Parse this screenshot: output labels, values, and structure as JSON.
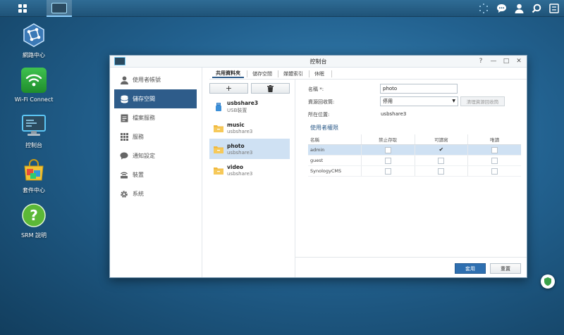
{
  "taskbar": {
    "main_menu_icon": "grid-icon",
    "open_app_icon": "control-panel-icon",
    "right_icons": [
      "network-dots-icon",
      "chat-icon",
      "user-icon",
      "search-icon",
      "options-icon"
    ]
  },
  "desktop": {
    "icons": [
      {
        "label": "網路中心",
        "icon": "network-center-icon"
      },
      {
        "label": "Wi-Fi Connect",
        "icon": "wifi-icon"
      },
      {
        "label": "控制台",
        "icon": "control-panel-icon"
      },
      {
        "label": "套件中心",
        "icon": "package-center-icon"
      },
      {
        "label": "SRM 說明",
        "icon": "help-icon"
      }
    ]
  },
  "window": {
    "title": "控制台",
    "controls": [
      "?",
      "—",
      "□",
      "✕"
    ],
    "sidebar": [
      {
        "label": "使用者帳號",
        "icon": "user-icon",
        "active": false
      },
      {
        "label": "儲存空間",
        "icon": "storage-icon",
        "active": true
      },
      {
        "label": "檔案服務",
        "icon": "file-services-icon",
        "active": false
      },
      {
        "label": "服務",
        "icon": "services-icon",
        "active": false
      },
      {
        "label": "通知設定",
        "icon": "notification-icon",
        "active": false
      },
      {
        "label": "裝置",
        "icon": "device-icon",
        "active": false
      },
      {
        "label": "系統",
        "icon": "system-icon",
        "active": false
      }
    ],
    "tabs": [
      {
        "label": "共用資料夾",
        "active": true
      },
      {
        "label": "儲存空間",
        "active": false
      },
      {
        "label": "媒體索引",
        "active": false
      },
      {
        "label": "休眠",
        "active": false
      }
    ],
    "list_toolbar": {
      "add": "+",
      "delete_icon": "trash-icon"
    },
    "shares": [
      {
        "name": "usbshare3",
        "sub": "USB裝置",
        "icon": "usb-icon",
        "selected": false
      },
      {
        "name": "music",
        "sub": "usbshare3",
        "icon": "folder-icon",
        "selected": false
      },
      {
        "name": "photo",
        "sub": "usbshare3",
        "icon": "folder-icon",
        "selected": true
      },
      {
        "name": "video",
        "sub": "usbshare3",
        "icon": "folder-icon",
        "selected": false
      }
    ],
    "form": {
      "name_label": "名稱 *:",
      "name_value": "photo",
      "recycle_label": "資源回收筒:",
      "recycle_value": "停用",
      "clear_recycle_btn": "清理資源回收筒",
      "location_label": "所在位置:",
      "location_value": "usbshare3",
      "perm_title": "使用者權限",
      "perm_headers": [
        "名稱",
        "禁止存取",
        "可讀寫",
        "唯讀"
      ],
      "perm_rows": [
        {
          "name": "admin",
          "deny": false,
          "rw": true,
          "ro": false,
          "selected": true
        },
        {
          "name": "guest",
          "deny": false,
          "rw": false,
          "ro": false,
          "selected": false
        },
        {
          "name": "SynologyCMS",
          "deny": false,
          "rw": false,
          "ro": false,
          "selected": false
        }
      ],
      "apply_btn": "套用",
      "reset_btn": "重置"
    }
  }
}
